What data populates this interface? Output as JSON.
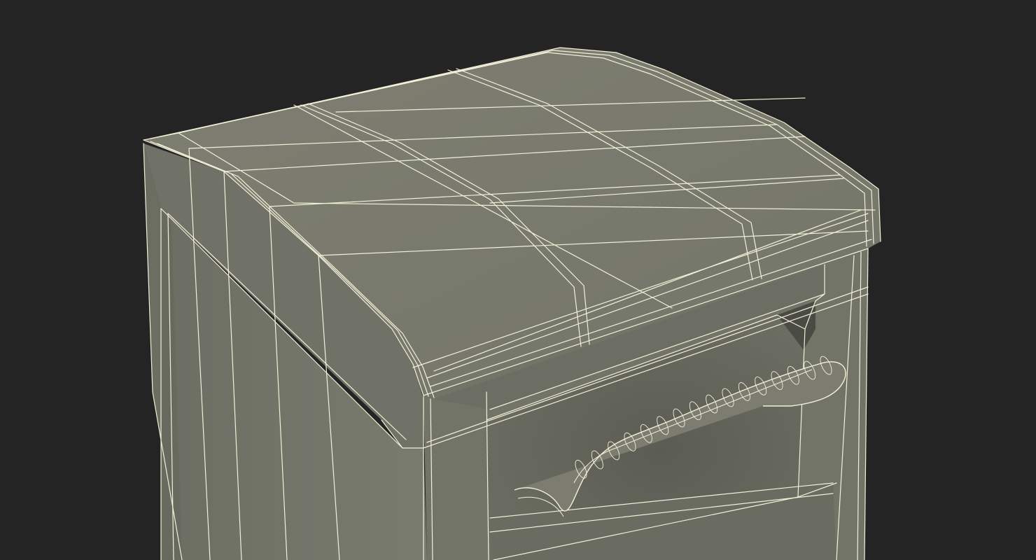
{
  "scene": {
    "subject_icon": "wireframe-cabinet-render",
    "colors": {
      "background": "#242424",
      "surface_top": "#7b7b6d",
      "surface_side": "#75766a",
      "surface_front": "#727367",
      "surface_shadow": "#5f6057",
      "wire": "#f3f0d8"
    }
  }
}
